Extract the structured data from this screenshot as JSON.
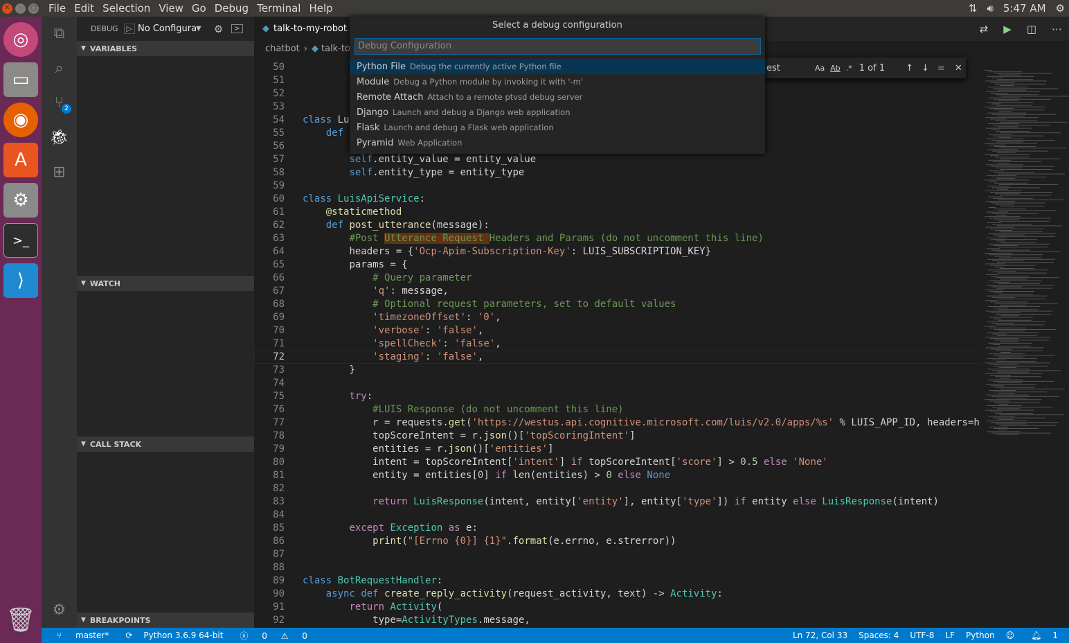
{
  "menubar": {
    "items": [
      "File",
      "Edit",
      "Selection",
      "View",
      "Go",
      "Debug",
      "Terminal",
      "Help"
    ],
    "clock": "5:47 AM"
  },
  "sidebar": {
    "title": "DEBUG",
    "config_select": "No Configura",
    "sections": {
      "variables": "VARIABLES",
      "watch": "WATCH",
      "call_stack": "CALL STACK",
      "breakpoints": "BREAKPOINTS"
    }
  },
  "activity": {
    "scm_badge": "2"
  },
  "editor": {
    "tab_label": "talk-to-my-robot.p",
    "breadcrumb": [
      "chatbot",
      "talk-to"
    ],
    "find": {
      "query": "est",
      "result": "1 of 1"
    }
  },
  "quickpick": {
    "title": "Select a debug configuration",
    "placeholder": "Debug Configuration",
    "items": [
      {
        "label": "Python File",
        "desc": "Debug the currently active Python file"
      },
      {
        "label": "Module",
        "desc": "Debug a Python module by invoking it with '-m'"
      },
      {
        "label": "Remote Attach",
        "desc": "Attach to a remote ptvsd debug server"
      },
      {
        "label": "Django",
        "desc": "Launch and debug a Django web application"
      },
      {
        "label": "Flask",
        "desc": "Launch and debug a Flask web application"
      },
      {
        "label": "Pyramid",
        "desc": "Web Application"
      }
    ]
  },
  "code_lines": [
    {
      "n": "50",
      "t": ""
    },
    {
      "n": "51",
      "t": ""
    },
    {
      "n": "52",
      "t": ""
    },
    {
      "n": "53",
      "t": ""
    },
    {
      "n": "54",
      "t": "class Lu"
    },
    {
      "n": "55",
      "t": "    def"
    },
    {
      "n": "56",
      "t": ""
    },
    {
      "n": "57",
      "t": "        self.entity_value = entity_value"
    },
    {
      "n": "58",
      "t": "        self.entity_type = entity_type"
    },
    {
      "n": "59",
      "t": ""
    },
    {
      "n": "60",
      "t": "class LuisApiService:"
    },
    {
      "n": "61",
      "t": "    @staticmethod"
    },
    {
      "n": "62",
      "t": "    def post_utterance(message):"
    },
    {
      "n": "63",
      "t": "        #Post Utterance Request Headers and Params (do not uncomment this line)"
    },
    {
      "n": "64",
      "t": "        headers = {'Ocp-Apim-Subscription-Key': LUIS_SUBSCRIPTION_KEY}"
    },
    {
      "n": "65",
      "t": "        params = {"
    },
    {
      "n": "66",
      "t": "            # Query parameter"
    },
    {
      "n": "67",
      "t": "            'q': message,"
    },
    {
      "n": "68",
      "t": "            # Optional request parameters, set to default values"
    },
    {
      "n": "69",
      "t": "            'timezoneOffset': '0',"
    },
    {
      "n": "70",
      "t": "            'verbose': 'false',"
    },
    {
      "n": "71",
      "t": "            'spellCheck': 'false',"
    },
    {
      "n": "72",
      "t": "            'staging': 'false',"
    },
    {
      "n": "73",
      "t": "        }"
    },
    {
      "n": "74",
      "t": ""
    },
    {
      "n": "75",
      "t": "        try:"
    },
    {
      "n": "76",
      "t": "            #LUIS Response (do not uncomment this line)"
    },
    {
      "n": "77",
      "t": "            r = requests.get('https://westus.api.cognitive.microsoft.com/luis/v2.0/apps/%s' % LUIS_APP_ID, headers=he"
    },
    {
      "n": "78",
      "t": "            topScoreIntent = r.json()['topScoringIntent']"
    },
    {
      "n": "79",
      "t": "            entities = r.json()['entities']"
    },
    {
      "n": "80",
      "t": "            intent = topScoreIntent['intent'] if topScoreIntent['score'] > 0.5 else 'None'"
    },
    {
      "n": "81",
      "t": "            entity = entities[0] if len(entities) > 0 else None"
    },
    {
      "n": "82",
      "t": ""
    },
    {
      "n": "83",
      "t": "            return LuisResponse(intent, entity['entity'], entity['type']) if entity else LuisResponse(intent)"
    },
    {
      "n": "84",
      "t": ""
    },
    {
      "n": "85",
      "t": "        except Exception as e:"
    },
    {
      "n": "86",
      "t": "            print(\"[Errno {0}] {1}\".format(e.errno, e.strerror))"
    },
    {
      "n": "87",
      "t": ""
    },
    {
      "n": "88",
      "t": ""
    },
    {
      "n": "89",
      "t": "class BotRequestHandler:"
    },
    {
      "n": "90",
      "t": "    async def create_reply_activity(request_activity, text) -> Activity:"
    },
    {
      "n": "91",
      "t": "        return Activity("
    },
    {
      "n": "92",
      "t": "            type=ActivityTypes.message,"
    }
  ],
  "statusbar": {
    "branch": "master*",
    "python": "Python 3.6.9 64-bit",
    "errors": "0",
    "warnings": "0",
    "position": "Ln 72, Col 33",
    "spaces": "Spaces: 4",
    "encoding": "UTF-8",
    "eol": "LF",
    "language": "Python",
    "notifications": "1"
  },
  "colors": {
    "accent": "#007acc",
    "launcher": "#6a2a55",
    "selection": "#073655"
  }
}
